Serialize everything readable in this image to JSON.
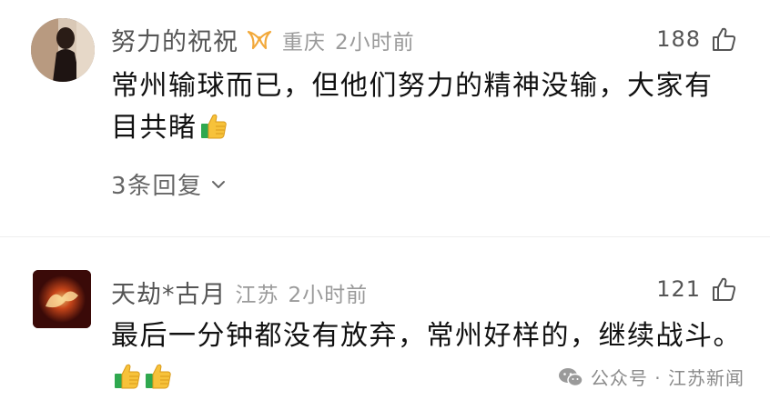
{
  "comments": [
    {
      "nickname": "努力的祝祝",
      "location": "重庆",
      "time": "2小时前",
      "likes": "188",
      "text_line1": "常州输球而已，但他们努力的精神没输，大家有",
      "text_line2": "目共睹",
      "emojis": [
        "thumbs-up"
      ],
      "replies": "3条回复",
      "badge_color": "#f2a93b"
    },
    {
      "nickname": "天劫*古月",
      "location": "江苏",
      "time": "2小时前",
      "likes": "121",
      "text_line1": "最后一分钟都没有放弃，常州好样的，继续战斗。",
      "emojis": [
        "thumbs-up",
        "thumbs-up"
      ]
    }
  ],
  "watermark": {
    "text": "公众号 · 江苏新闻",
    "icon": "wechat-icon"
  },
  "colors": {
    "emoji_yellow": "#f7c23a",
    "emoji_green": "#2fa84f"
  }
}
